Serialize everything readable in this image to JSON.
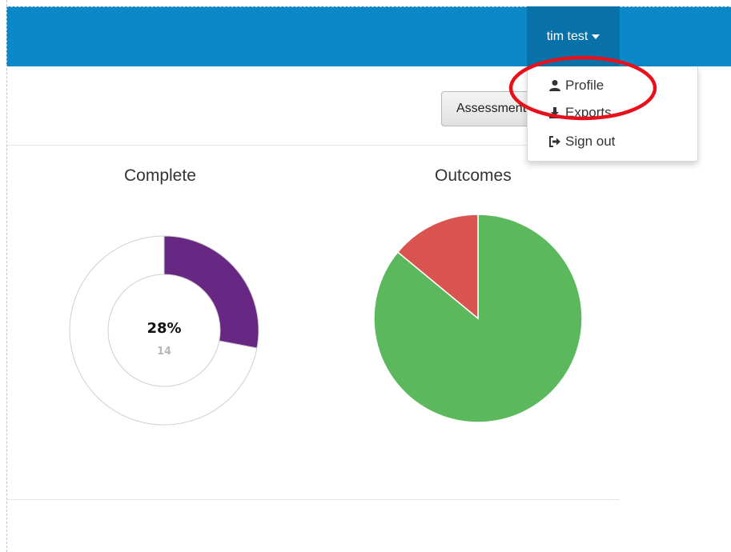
{
  "navbar": {
    "user_name": "tim test",
    "bg_color": "#0a88c8"
  },
  "toolbar": {
    "assessment_button_label": "Assessment"
  },
  "user_dropdown": {
    "items": [
      {
        "label": "Profile",
        "icon": "user-icon"
      },
      {
        "label": "Exports",
        "icon": "download-icon"
      },
      {
        "label": "Sign out",
        "icon": "sign-out-icon"
      }
    ]
  },
  "charts": {
    "complete": {
      "title": "Complete",
      "percent_label": "28%",
      "count_label": "14"
    },
    "outcomes": {
      "title": "Outcomes"
    }
  },
  "chart_data": [
    {
      "type": "pie",
      "title": "Complete",
      "variant": "donut",
      "values": [
        28,
        72
      ],
      "colors": [
        "#672783",
        "#ffffff"
      ],
      "center_label": "28%",
      "center_sublabel": "14"
    },
    {
      "type": "pie",
      "title": "Outcomes",
      "values": [
        86,
        14
      ],
      "colors": [
        "#5cb85c",
        "#d9534f"
      ]
    }
  ]
}
